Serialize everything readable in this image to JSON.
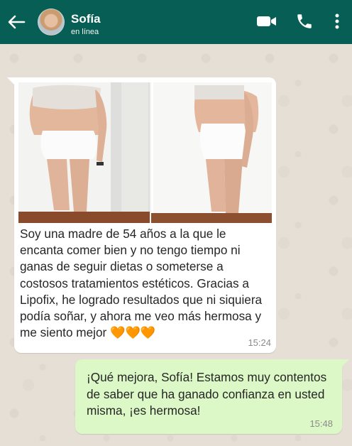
{
  "header": {
    "contact_name": "Sofía",
    "status": "en línea"
  },
  "icons": {
    "back": "arrow-left-icon",
    "video": "video-camera-icon",
    "phone": "phone-icon",
    "menu": "more-vertical-icon"
  },
  "incoming": {
    "text": "Soy una madre de 54 años a la que le encanta comer bien y no tengo tiempo ni ganas de seguir dietas o someterse a costosos tratamientos estéticos. Gracias a Lipofix, he logrado resultados que ni siquiera podía soñar, y ahora me veo más hermosa y me siento mejor 🧡🧡🧡",
    "time": "15:24"
  },
  "outgoing": {
    "text": "¡Qué mejora, Sofía! Estamos muy contentos de saber que ha ganado confianza en usted misma, ¡es hermosa!",
    "time": "15:48"
  },
  "colors": {
    "header": "#075e54",
    "incoming_bubble": "#ffffff",
    "outgoing_bubble": "#dcf8c6",
    "background": "#e6dfd6"
  }
}
